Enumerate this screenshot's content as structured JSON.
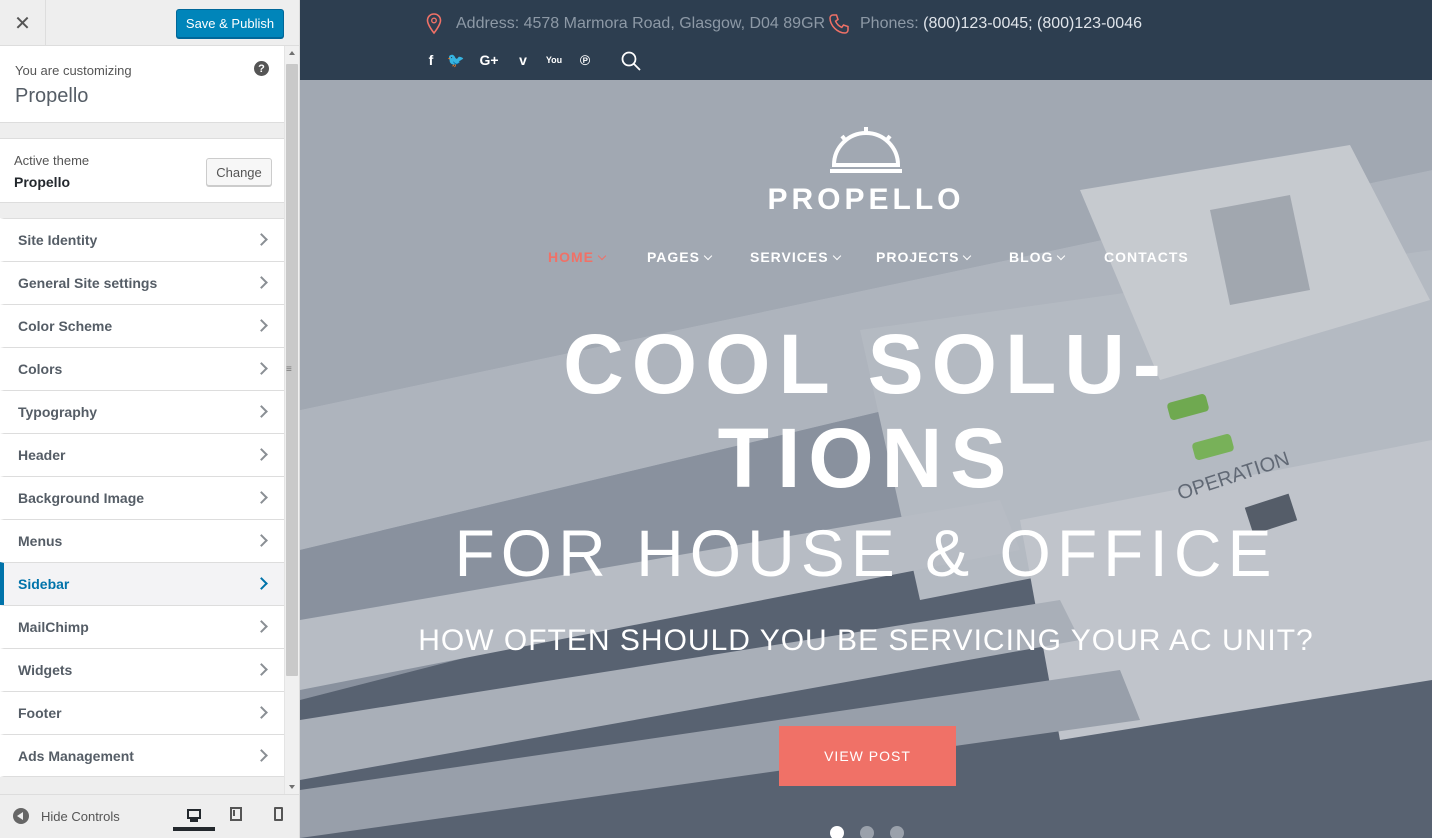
{
  "customizer": {
    "close_label": "✕",
    "publish_label": "Save & Publish",
    "customizing_label": "You are customizing",
    "site_title": "Propello",
    "help_glyph": "?",
    "active_theme_label": "Active theme",
    "active_theme_name": "Propello",
    "change_label": "Change",
    "panels": [
      {
        "label": "Site Identity",
        "active": false
      },
      {
        "label": "General Site settings",
        "active": false
      },
      {
        "label": "Color Scheme",
        "active": false
      },
      {
        "label": "Colors",
        "active": false
      },
      {
        "label": "Typography",
        "active": false
      },
      {
        "label": "Header",
        "active": false
      },
      {
        "label": "Background Image",
        "active": false
      },
      {
        "label": "Menus",
        "active": false
      },
      {
        "label": "Sidebar",
        "active": true
      },
      {
        "label": "MailChimp",
        "active": false
      },
      {
        "label": "Widgets",
        "active": false
      },
      {
        "label": "Footer",
        "active": false
      },
      {
        "label": "Ads Management",
        "active": false
      }
    ],
    "hide_controls_label": "Hide Controls",
    "devices": [
      "desktop",
      "tablet",
      "mobile"
    ],
    "selected_device": "desktop"
  },
  "preview": {
    "address": "Address: 4578 Marmora Road, Glasgow, D04 89GR",
    "phones_label": "Phones:",
    "phones": "(800)123-0045; (800)123-0046",
    "social_icons": [
      {
        "name": "facebook-icon",
        "glyph": "f"
      },
      {
        "name": "twitter-icon",
        "glyph": "🐦"
      },
      {
        "name": "google-plus-icon",
        "glyph": "G+"
      },
      {
        "name": "vimeo-icon",
        "glyph": "v"
      },
      {
        "name": "youtube-icon",
        "glyph": "You"
      },
      {
        "name": "pinterest-icon",
        "glyph": "℗"
      }
    ],
    "logo_text": "PROPELLO",
    "nav": [
      {
        "label": "HOME",
        "caret": true,
        "current": true
      },
      {
        "label": "PAGES",
        "caret": true,
        "current": false
      },
      {
        "label": "SERVICES",
        "caret": true,
        "current": false
      },
      {
        "label": "PROJECTS",
        "caret": true,
        "current": false
      },
      {
        "label": "BLOG",
        "caret": true,
        "current": false
      },
      {
        "label": "CONTACTS",
        "caret": false,
        "current": false
      }
    ],
    "hero_line1": "COOL SOLU-",
    "hero_line2": "TIONS",
    "hero_line3": "FOR HOUSE & OFFICE",
    "hero_line4": "HOW OFTEN SHOULD YOU BE SERVICING YOUR AC UNIT?",
    "photo_label": "OPERATION",
    "cta_label": "VIEW POST",
    "slider_dots": 3,
    "active_dot": 0
  },
  "colors": {
    "publish_blue": "#0085ba",
    "active_panel": "#0073aa",
    "topbar_navy": "#2d3e50",
    "accent_coral": "#f07167"
  }
}
